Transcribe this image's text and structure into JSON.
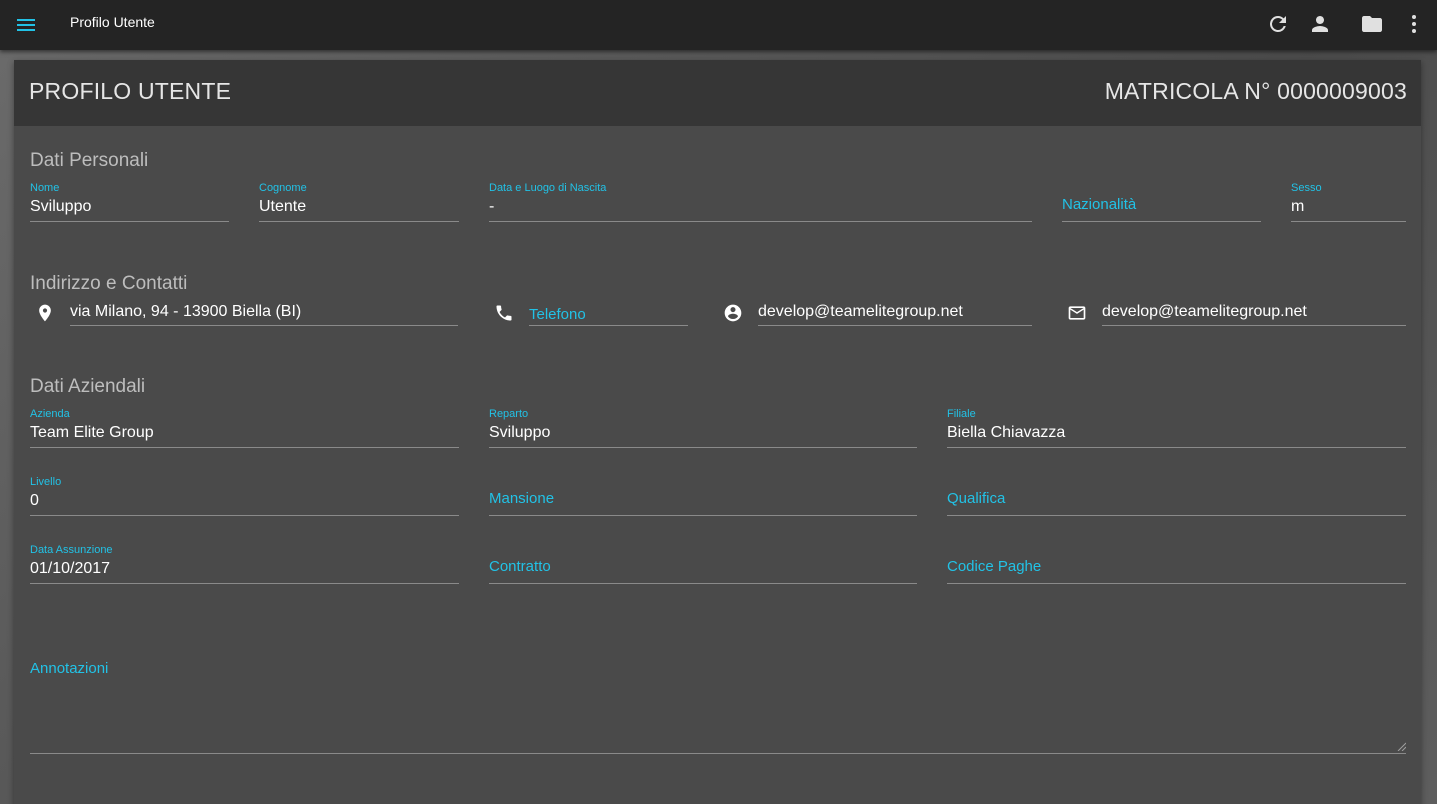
{
  "toolbar": {
    "title": "Profilo Utente",
    "icons": [
      "menu-icon",
      "refresh-icon",
      "person-icon",
      "folder-icon",
      "more-vert-icon"
    ]
  },
  "card": {
    "title": "PROFILO UTENTE",
    "matricola": "MATRICOLA N° 0000009003"
  },
  "personal": {
    "title": "Dati Personali",
    "nome": {
      "label": "Nome",
      "value": "Sviluppo"
    },
    "cognome": {
      "label": "Cognome",
      "value": "Utente"
    },
    "nascita": {
      "label": "Data e Luogo di Nascita",
      "value": "-"
    },
    "nazionalita": {
      "placeholder": "Nazionalità"
    },
    "sesso": {
      "label": "Sesso",
      "value": "m"
    }
  },
  "contacts": {
    "title": "Indirizzo e Contatti",
    "indirizzo": "via Milano, 94 - 13900 Biella (BI)",
    "telefono_placeholder": "Telefono",
    "account": "develop@teamelitegroup.net",
    "email": "develop@teamelitegroup.net"
  },
  "company": {
    "title": "Dati Aziendali",
    "azienda": {
      "label": "Azienda",
      "value": "Team Elite Group"
    },
    "reparto": {
      "label": "Reparto",
      "value": "Sviluppo"
    },
    "filiale": {
      "label": "Filiale",
      "value": "Biella Chiavazza"
    },
    "livello": {
      "label": "Livello",
      "value": "0"
    },
    "mansione_placeholder": "Mansione",
    "qualifica_placeholder": "Qualifica",
    "assunzione": {
      "label": "Data Assunzione",
      "value": "01/10/2017"
    },
    "contratto_placeholder": "Contratto",
    "codice_paghe_placeholder": "Codice Paghe",
    "annotazioni_placeholder": "Annotazioni"
  },
  "colors": {
    "accent": "#22c2e6",
    "toolbar": "#242424",
    "card": "#4a4a4a",
    "card_header": "#363636"
  }
}
